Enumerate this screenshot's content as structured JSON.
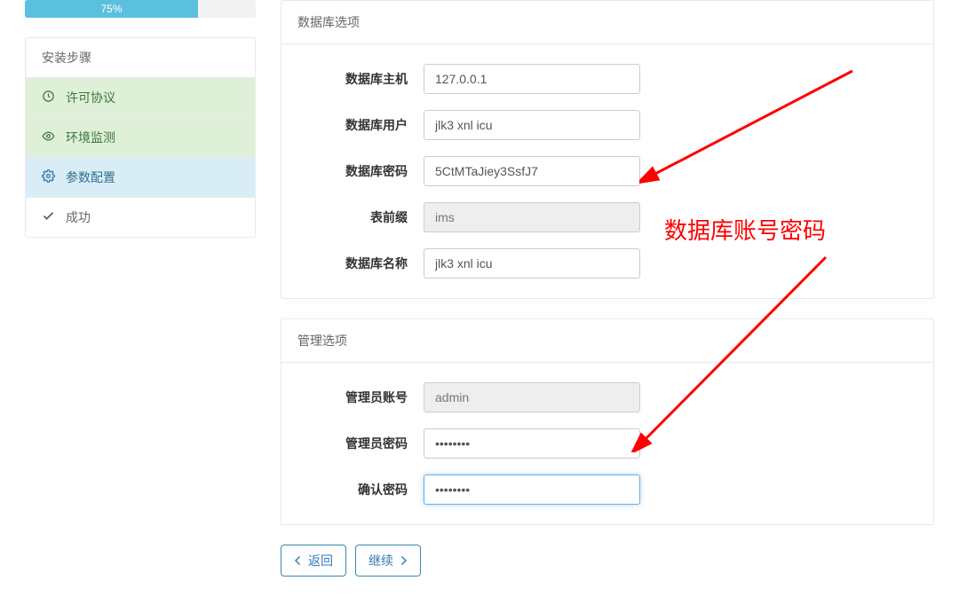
{
  "progress": {
    "label": "75%",
    "percent": 75
  },
  "sidebar": {
    "title": "安装步骤",
    "items": [
      {
        "label": "许可协议",
        "state": "done",
        "icon": "clock-icon"
      },
      {
        "label": "环境监测",
        "state": "done",
        "icon": "eye-icon"
      },
      {
        "label": "参数配置",
        "state": "active",
        "icon": "gear-icon"
      },
      {
        "label": "成功",
        "state": "pending",
        "icon": "checkmark-icon"
      }
    ]
  },
  "panels": {
    "db": {
      "title": "数据库选项",
      "fields": {
        "host": {
          "label": "数据库主机",
          "value": "127.0.0.1"
        },
        "user": {
          "label": "数据库用户",
          "value": "jlk3 xnl icu"
        },
        "password": {
          "label": "数据库密码",
          "value": "5CtMTaJiey3SsfJ7"
        },
        "prefix": {
          "label": "表前缀",
          "value": "ims",
          "readonly": true
        },
        "dbname": {
          "label": "数据库名称",
          "value": "jlk3 xnl icu"
        }
      }
    },
    "admin": {
      "title": "管理选项",
      "fields": {
        "account": {
          "label": "管理员账号",
          "value": "admin",
          "readonly": true
        },
        "password": {
          "label": "管理员密码",
          "value": "••••••••"
        },
        "confirm": {
          "label": "确认密码",
          "value": "••••••••"
        }
      }
    }
  },
  "buttons": {
    "back": "返回",
    "next": "继续"
  },
  "annotation": {
    "text": "数据库账号密码"
  }
}
